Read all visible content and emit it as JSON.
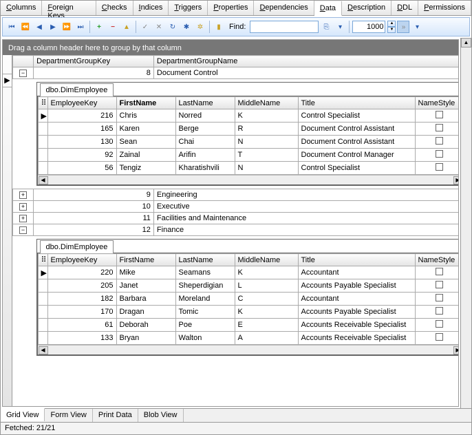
{
  "tabs_top": [
    "Columns",
    "Foreign Keys",
    "Checks",
    "Indices",
    "Triggers",
    "Properties",
    "Dependencies",
    "Data",
    "Description",
    "DDL",
    "Permissions"
  ],
  "tabs_top_active": 7,
  "toolbar": {
    "find_label": "Find:",
    "find_value": "",
    "spin_value": "1000"
  },
  "group_panel": "Drag a column header here to group by that column",
  "master_cols": [
    "DepartmentGroupKey",
    "DepartmentGroupName"
  ],
  "groups": [
    {
      "key": 8,
      "name": "Document Control",
      "expanded": true
    },
    {
      "key": 9,
      "name": "Engineering",
      "expanded": false
    },
    {
      "key": 10,
      "name": "Executive",
      "expanded": false
    },
    {
      "key": 11,
      "name": "Facilities and Maintenance",
      "expanded": false
    },
    {
      "key": 12,
      "name": "Finance",
      "expanded": true
    }
  ],
  "detail_tab": "dbo.DimEmployee",
  "detail_cols": [
    "EmployeeKey",
    "FirstName",
    "LastName",
    "MiddleName",
    "Title",
    "NameStyle"
  ],
  "detail_bold_col": 1,
  "group_8_rows": [
    {
      "key": 216,
      "first": "Chris",
      "last": "Norred",
      "mid": "K",
      "title": "Control Specialist",
      "ns": false
    },
    {
      "key": 165,
      "first": "Karen",
      "last": "Berge",
      "mid": "R",
      "title": "Document Control Assistant",
      "ns": false
    },
    {
      "key": 130,
      "first": "Sean",
      "last": "Chai",
      "mid": "N",
      "title": "Document Control Assistant",
      "ns": false
    },
    {
      "key": 92,
      "first": "Zainal",
      "last": "Arifin",
      "mid": "T",
      "title": "Document Control Manager",
      "ns": false
    },
    {
      "key": 56,
      "first": "Tengiz",
      "last": "Kharatishvili",
      "mid": "N",
      "title": "Control Specialist",
      "ns": false
    }
  ],
  "group_12_rows": [
    {
      "key": 220,
      "first": "Mike",
      "last": "Seamans",
      "mid": "K",
      "title": "Accountant",
      "ns": false
    },
    {
      "key": 205,
      "first": "Janet",
      "last": "Sheperdigian",
      "mid": "L",
      "title": "Accounts Payable Specialist",
      "ns": false
    },
    {
      "key": 182,
      "first": "Barbara",
      "last": "Moreland",
      "mid": "C",
      "title": "Accountant",
      "ns": false
    },
    {
      "key": 170,
      "first": "Dragan",
      "last": "Tomic",
      "mid": "K",
      "title": "Accounts Payable Specialist",
      "ns": false
    },
    {
      "key": 61,
      "first": "Deborah",
      "last": "Poe",
      "mid": "E",
      "title": "Accounts Receivable Specialist",
      "ns": false
    },
    {
      "key": 133,
      "first": "Bryan",
      "last": "Walton",
      "mid": "A",
      "title": "Accounts Receivable Specialist",
      "ns": false
    }
  ],
  "tabs_bottom": [
    "Grid View",
    "Form View",
    "Print Data",
    "Blob View"
  ],
  "tabs_bottom_active": 0,
  "status": "Fetched: 21/21"
}
